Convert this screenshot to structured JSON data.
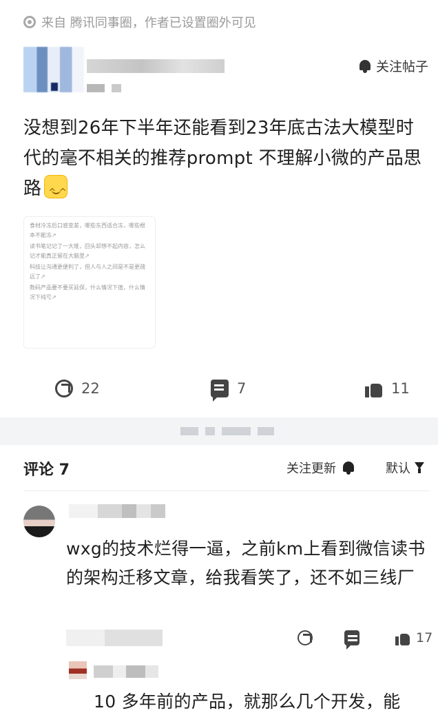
{
  "source_line": "来自 腾讯同事圈，作者已设置圈外可见",
  "header": {
    "follow_post_label": "关注帖子"
  },
  "post": {
    "text": "没想到26年下半年还能看到23年底古法大模型时代的毫不相关的推荐prompt 不理解小微的产品思路",
    "image_lines": [
      "食材冷冻后口感变差，哪些东西适合冻，哪些根本不能冻↗",
      "读书笔记记了一大堆，回头却想不起内容，怎么记才能真正留在大脑里↗",
      "科技让沟通更便利了，但人与人之间是不是更疏远了↗",
      "数码产品要不要买延保，什么情况下值，什么情况下纯亏↗"
    ],
    "share_count": "22",
    "comment_count": "7",
    "like_count": "11"
  },
  "comments_section": {
    "title": "评论 7",
    "follow_updates_label": "关注更新",
    "sort_label": "默认"
  },
  "comments": [
    {
      "text": "wxg的技术烂得一逼，之前km上看到微信读书的架构迁移文章，给我看笑了，还不如三线厂",
      "like_count": "17"
    },
    {
      "text": "10 多年前的产品，就那么几个开发，能"
    }
  ],
  "icons": {
    "source": "location-pin-icon",
    "follow": "bell-icon",
    "share": "share-icon",
    "comment": "comment-icon",
    "like": "thumbs-up-icon",
    "sort": "filter-icon"
  }
}
